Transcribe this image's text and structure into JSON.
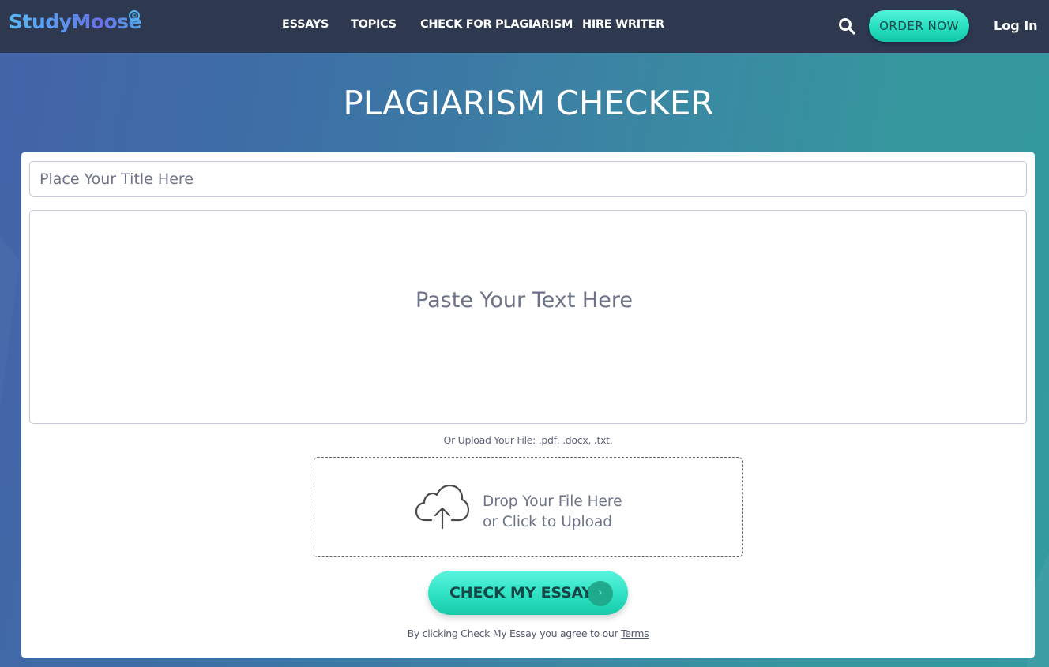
{
  "header": {
    "logo_text": "StudyMoose",
    "logo_mark": "©",
    "nav": [
      {
        "label": "ESSAYS"
      },
      {
        "label": "TOPICS"
      },
      {
        "label": "CHECK FOR PLAGIARISM"
      },
      {
        "label": "HIRE WRITER"
      }
    ],
    "search_icon": "search-icon",
    "order_button": "ORDER NOW",
    "login": "Log In"
  },
  "page": {
    "title": "PLAGIARISM CHECKER"
  },
  "form": {
    "title_placeholder": "Place Your Title Here",
    "title_value": "",
    "text_placeholder": "Paste Your Text Here",
    "text_value": "",
    "upload_hint": "Or Upload Your File: .pdf, .docx, .txt.",
    "dropzone": {
      "icon": "cloud-upload-icon",
      "line1": "Drop Your File Here",
      "line2": "or Click to Upload"
    },
    "submit_label": "CHECK MY ESSAY",
    "submit_arrow": "›",
    "terms_prefix": "By clicking Check My Essay you agree to our ",
    "terms_link": "Terms"
  },
  "colors": {
    "header_bg": "#2e384e",
    "accent": "#2ee1c3",
    "accent_dark": "#1fa98d",
    "gradient_left": "#4463a8",
    "gradient_right": "#339a9f"
  }
}
